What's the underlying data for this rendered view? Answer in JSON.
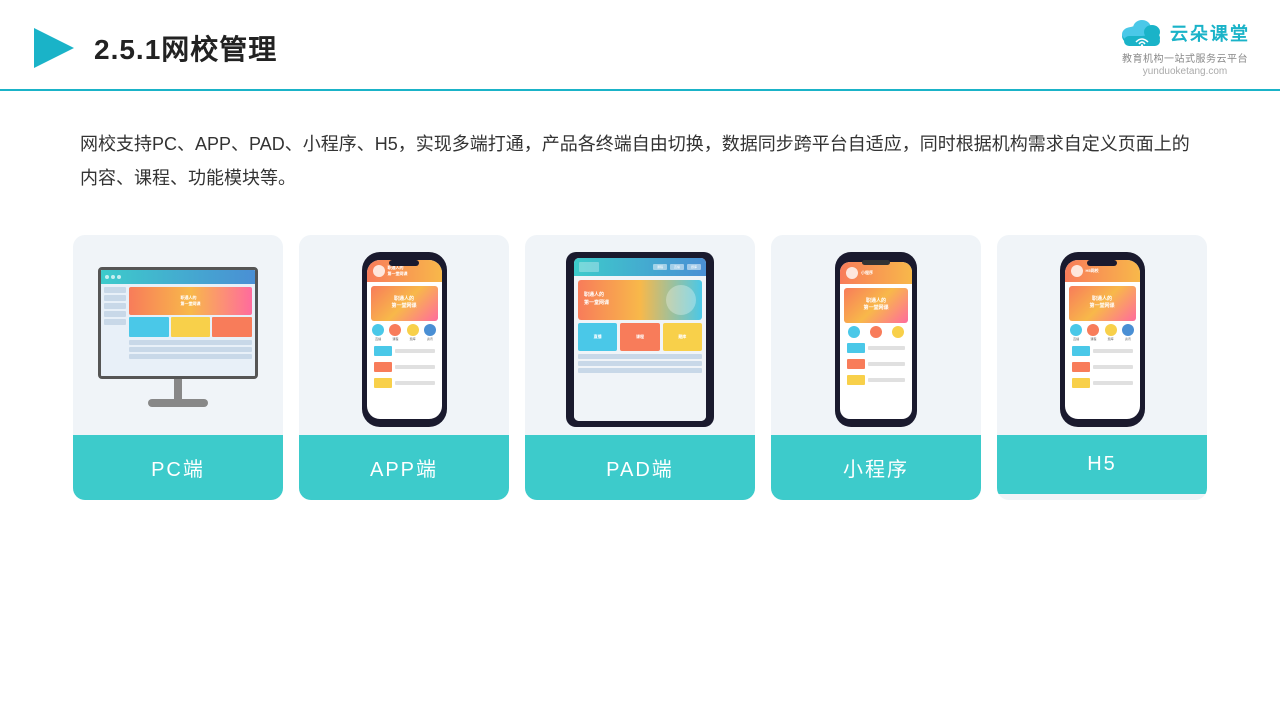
{
  "header": {
    "title": "2.5.1网校管理",
    "logo_text": "云朵课堂",
    "logo_sub": "教育机构一站\n式服务云平台",
    "logo_url": "yunduoketang.com"
  },
  "description": "网校支持PC、APP、PAD、小程序、H5，实现多端打通，产品各终端自由切换，数据同步跨平台自适应，同时根据机构需求自定义页面上的内容、课程、功能模块等。",
  "cards": [
    {
      "id": "pc",
      "label": "PC端",
      "type": "pc"
    },
    {
      "id": "app",
      "label": "APP端",
      "type": "phone"
    },
    {
      "id": "pad",
      "label": "PAD端",
      "type": "tablet"
    },
    {
      "id": "miniapp",
      "label": "小程序",
      "type": "phone"
    },
    {
      "id": "h5",
      "label": "H5",
      "type": "phone"
    }
  ],
  "colors": {
    "accent": "#3dcbcb",
    "card_bg": "#eef2f7",
    "label_bg": "#3dcbcb"
  }
}
